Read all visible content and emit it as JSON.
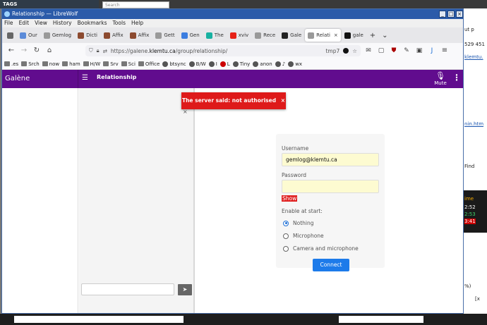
{
  "desktop": {
    "tags_label": "TAGS",
    "search_placeholder": "Search",
    "right_snippets": [
      "ut p",
      "529 451",
      "klemtu.",
      "nin.htm",
      "Find",
      "ime",
      "2:52",
      "2:53",
      "3:41",
      "%)",
      "[x"
    ],
    "bottom_bar": ""
  },
  "window": {
    "title": "Relationship — LibreWolf",
    "controls": [
      "_",
      "□",
      "×"
    ]
  },
  "menu": [
    "File",
    "Edit",
    "View",
    "History",
    "Bookmarks",
    "Tools",
    "Help"
  ],
  "tabs": [
    {
      "label": "",
      "icon": "chevron-left-icon",
      "color": "#666"
    },
    {
      "label": "Our",
      "icon": "mastodon-icon",
      "color": "#5b8bd9"
    },
    {
      "label": "Gemlog",
      "icon": "page-icon",
      "color": "#999"
    },
    {
      "label": "Dicti",
      "icon": "a-icon",
      "color": "#8c4a2f"
    },
    {
      "label": "Affix",
      "icon": "a-icon",
      "color": "#8c4a2f"
    },
    {
      "label": "Affix",
      "icon": "a-icon",
      "color": "#8c4a2f"
    },
    {
      "label": "Gett",
      "icon": "page-icon",
      "color": "#999"
    },
    {
      "label": "Gen",
      "icon": "search-icon",
      "color": "#3b7de0"
    },
    {
      "label": "The",
      "icon": "x-icon",
      "color": "#18b1a1"
    },
    {
      "label": "xviv",
      "icon": "youtube-icon",
      "color": "#e62117"
    },
    {
      "label": "Rece",
      "icon": "page-icon",
      "color": "#999"
    },
    {
      "label": "Gale",
      "icon": "y-icon",
      "color": "#222"
    },
    {
      "label": "Relati",
      "icon": "page-icon",
      "color": "#999",
      "active": true
    },
    {
      "label": "gale",
      "icon": "github-icon",
      "color": "#111"
    }
  ],
  "tab_actions": {
    "close": "×",
    "new": "+",
    "list": "⌄"
  },
  "nav": {
    "back": "←",
    "forward": "→",
    "reload": "↻",
    "home": "⌂",
    "url_prefix": "https://galene.",
    "url_domain": "klemtu.ca",
    "url_path": "/group/relationship/",
    "container": "tmp7"
  },
  "bookmarks": [
    ".es",
    "Srch",
    "now",
    "ham",
    "H/W",
    "Srv",
    "Sci",
    "Office",
    "btsync",
    "B/W",
    "I",
    "L",
    "Tiny",
    "anon",
    "♪",
    "wx"
  ],
  "app": {
    "brand": "Galène",
    "title": "Relationship",
    "mute_label": "Mute",
    "toast_message": "The server said: not authorised",
    "toast_close": "×",
    "send_glyph": "➤",
    "login": {
      "username_label": "Username",
      "username_value": "gemlog@klemtu.ca",
      "password_label": "Password",
      "password_value": "",
      "show_label": "Show",
      "enable_label": "Enable at start:",
      "options": [
        "Nothing",
        "Microphone",
        "Camera and microphone"
      ],
      "selected_index": 0,
      "connect_label": "Connect"
    }
  },
  "colors": {
    "header": "#610c8e",
    "toast": "#de1a1a",
    "connect": "#1d7bea",
    "input_bg": "#fdfbd1",
    "titlebar": "#2b5ba9"
  }
}
